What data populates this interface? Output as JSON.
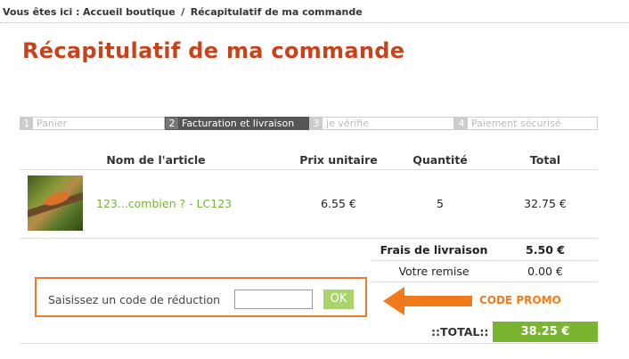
{
  "breadcrumb": {
    "prefix": "Vous êtes ici :",
    "home": "Accueil boutique",
    "separator": "/",
    "current": "Récapitulatif de ma commande"
  },
  "page_title": "Récapitulatif de ma commande",
  "steps": [
    {
      "num": "1",
      "label": "Panier"
    },
    {
      "num": "2",
      "label": "Facturation et livraison"
    },
    {
      "num": "3",
      "label": "je vérifie"
    },
    {
      "num": "4",
      "label": "Paiement sécurisé"
    }
  ],
  "table": {
    "headers": {
      "name": "Nom de l'article",
      "unit_price": "Prix unitaire",
      "quantity": "Quantité",
      "total": "Total"
    },
    "items": [
      {
        "name": "123...combien ? - LC123",
        "unit_price": "6.55 €",
        "quantity": "5",
        "total": "32.75 €"
      }
    ],
    "shipping": {
      "label": "Frais de livraison",
      "value": "5.50 €"
    },
    "discount": {
      "label": "Votre remise",
      "value": "0.00 €"
    },
    "grand_total": {
      "label": "::TOTAL::",
      "value": "38.25 €"
    }
  },
  "promo": {
    "label": "Saisissez un code de réduction",
    "input_value": "",
    "button": "OK",
    "annotation": "CODE PROMO"
  },
  "colors": {
    "title": "#c7431c",
    "link": "#7ab03a",
    "total_bg": "#7ab531",
    "promo_orange": "#ee7a2e",
    "step_active": "#555555"
  }
}
